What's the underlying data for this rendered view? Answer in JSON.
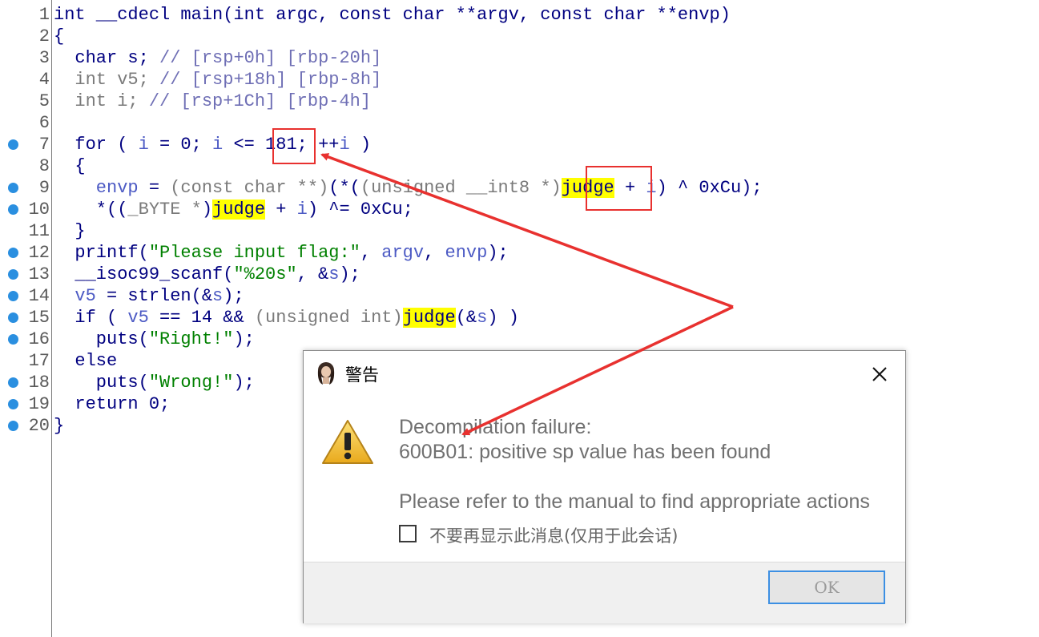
{
  "code": {
    "lines": [
      {
        "no": "1",
        "bp": false,
        "segments": [
          {
            "c": "t-kw",
            "t": "int __cdecl main(int argc, const char **argv, const char **envp)"
          }
        ]
      },
      {
        "no": "2",
        "bp": false,
        "segments": [
          {
            "c": "t-plain",
            "t": "{"
          }
        ]
      },
      {
        "no": "3",
        "bp": false,
        "segments": [
          {
            "c": "t-plain",
            "t": "  char s; "
          },
          {
            "c": "t-cmt",
            "t": "// [rsp+0h] [rbp-20h]"
          }
        ]
      },
      {
        "no": "4",
        "bp": false,
        "segments": [
          {
            "c": "t-dim",
            "t": "  int v5; "
          },
          {
            "c": "t-cmt",
            "t": "// [rsp+18h] [rbp-8h]"
          }
        ]
      },
      {
        "no": "5",
        "bp": false,
        "segments": [
          {
            "c": "t-dim",
            "t": "  int i; "
          },
          {
            "c": "t-cmt",
            "t": "// [rsp+1Ch] [rbp-4h]"
          }
        ]
      },
      {
        "no": "6",
        "bp": false,
        "segments": [
          {
            "c": "t-plain",
            "t": ""
          }
        ]
      },
      {
        "no": "7",
        "bp": true,
        "segments": [
          {
            "c": "t-plain",
            "t": "  for ( "
          },
          {
            "c": "t-var",
            "t": "i"
          },
          {
            "c": "t-plain",
            "t": " = 0; "
          },
          {
            "c": "t-var",
            "t": "i"
          },
          {
            "c": "t-plain",
            "t": " <= 181; ++"
          },
          {
            "c": "t-var",
            "t": "i"
          },
          {
            "c": "t-plain",
            "t": " )"
          }
        ]
      },
      {
        "no": "8",
        "bp": false,
        "segments": [
          {
            "c": "t-plain",
            "t": "  {"
          }
        ]
      },
      {
        "no": "9",
        "bp": true,
        "segments": [
          {
            "c": "t-var",
            "t": "    envp"
          },
          {
            "c": "t-plain",
            "t": " = "
          },
          {
            "c": "t-dim",
            "t": "(const char **)"
          },
          {
            "c": "t-plain",
            "t": "(*("
          },
          {
            "c": "t-dim",
            "t": "(unsigned __int8 *)"
          },
          {
            "c": "t-hl",
            "t": "judge"
          },
          {
            "c": "t-plain",
            "t": " + "
          },
          {
            "c": "t-var",
            "t": "i"
          },
          {
            "c": "t-plain",
            "t": ") ^ 0xCu);"
          }
        ]
      },
      {
        "no": "10",
        "bp": true,
        "segments": [
          {
            "c": "t-plain",
            "t": "    *(("
          },
          {
            "c": "t-dim",
            "t": "_BYTE *"
          },
          {
            "c": "t-plain",
            "t": ")"
          },
          {
            "c": "t-hl",
            "t": "judge"
          },
          {
            "c": "t-plain",
            "t": " + "
          },
          {
            "c": "t-var",
            "t": "i"
          },
          {
            "c": "t-plain",
            "t": ") ^= 0xCu;"
          }
        ]
      },
      {
        "no": "11",
        "bp": false,
        "segments": [
          {
            "c": "t-plain",
            "t": "  }"
          }
        ]
      },
      {
        "no": "12",
        "bp": true,
        "segments": [
          {
            "c": "t-plain",
            "t": "  printf("
          },
          {
            "c": "t-str",
            "t": "\"Please input flag:\""
          },
          {
            "c": "t-plain",
            "t": ", "
          },
          {
            "c": "t-var",
            "t": "argv"
          },
          {
            "c": "t-plain",
            "t": ", "
          },
          {
            "c": "t-var",
            "t": "envp"
          },
          {
            "c": "t-plain",
            "t": ");"
          }
        ]
      },
      {
        "no": "13",
        "bp": true,
        "segments": [
          {
            "c": "t-plain",
            "t": "  __isoc99_scanf("
          },
          {
            "c": "t-str",
            "t": "\"%20s\""
          },
          {
            "c": "t-plain",
            "t": ", &"
          },
          {
            "c": "t-var",
            "t": "s"
          },
          {
            "c": "t-plain",
            "t": ");"
          }
        ]
      },
      {
        "no": "14",
        "bp": true,
        "segments": [
          {
            "c": "t-var",
            "t": "  v5"
          },
          {
            "c": "t-plain",
            "t": " = strlen(&"
          },
          {
            "c": "t-var",
            "t": "s"
          },
          {
            "c": "t-plain",
            "t": ");"
          }
        ]
      },
      {
        "no": "15",
        "bp": true,
        "segments": [
          {
            "c": "t-plain",
            "t": "  if ( "
          },
          {
            "c": "t-var",
            "t": "v5"
          },
          {
            "c": "t-plain",
            "t": " == 14 && "
          },
          {
            "c": "t-dim",
            "t": "(unsigned int)"
          },
          {
            "c": "t-hl",
            "t": "judge"
          },
          {
            "c": "t-plain",
            "t": "(&"
          },
          {
            "c": "t-var",
            "t": "s"
          },
          {
            "c": "t-plain",
            "t": ") )"
          }
        ]
      },
      {
        "no": "16",
        "bp": true,
        "segments": [
          {
            "c": "t-plain",
            "t": "    puts("
          },
          {
            "c": "t-str",
            "t": "\"Right!\""
          },
          {
            "c": "t-plain",
            "t": ");"
          }
        ]
      },
      {
        "no": "17",
        "bp": false,
        "segments": [
          {
            "c": "t-plain",
            "t": "  else"
          }
        ]
      },
      {
        "no": "18",
        "bp": true,
        "segments": [
          {
            "c": "t-plain",
            "t": "    puts("
          },
          {
            "c": "t-str",
            "t": "\"Wrong!\""
          },
          {
            "c": "t-plain",
            "t": ");"
          }
        ]
      },
      {
        "no": "19",
        "bp": true,
        "segments": [
          {
            "c": "t-plain",
            "t": "  return 0;"
          }
        ]
      },
      {
        "no": "20",
        "bp": true,
        "segments": [
          {
            "c": "t-plain",
            "t": "}"
          }
        ]
      }
    ]
  },
  "dialog": {
    "title": "警告",
    "message_line1": "Decompilation failure:",
    "address": "600B01",
    "message_line2_rest": ": positive sp value has been found",
    "message_line3": "Please refer to the manual to find appropriate actions",
    "checkbox_label": "不要再显示此消息(仅用于此会话)",
    "checkbox_checked": false,
    "ok_label": "OK"
  },
  "colors": {
    "annotation": "#e8312f",
    "breakpoint": "#2a8fe0",
    "highlight": "#ffff00",
    "ok_border": "#3c8fe3"
  },
  "icons": {
    "dialog_app": "avatar-icon",
    "warning": "warning-triangle-icon",
    "close": "close-icon"
  }
}
